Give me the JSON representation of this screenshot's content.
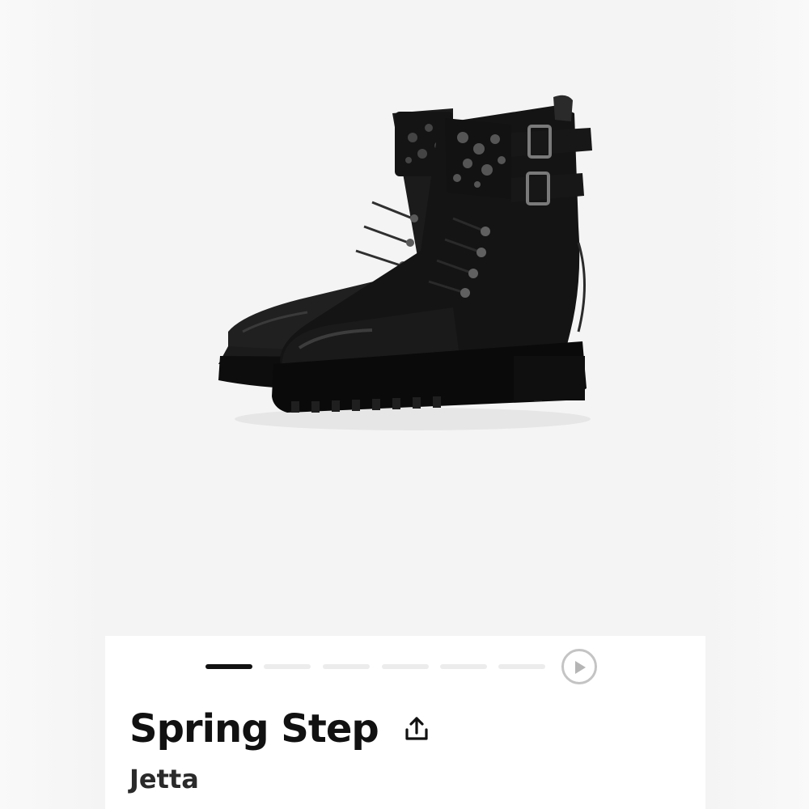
{
  "product": {
    "brand": "Spring Step",
    "name": "Jetta",
    "image_icon": "ankle-boots-image"
  },
  "gallery": {
    "total_slides": 6,
    "active_slide": 1,
    "has_video": true
  },
  "icons": {
    "share": "share-icon",
    "play": "play-icon"
  },
  "colors": {
    "background": "#f7f7f7",
    "card": "#ffffff",
    "gallery_bg": "#f4f4f4",
    "dot_active": "#111111",
    "dot_inactive": "#ececec",
    "play_border": "#c4c4c4",
    "text": "#111111"
  }
}
